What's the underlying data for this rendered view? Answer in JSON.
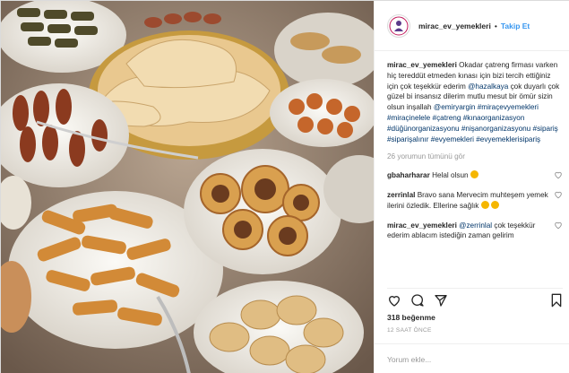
{
  "header": {
    "username": "mirac_ev_yemekleri",
    "separator": "•",
    "follow_label": "Takip Et"
  },
  "caption": {
    "username": "mirac_ev_yemekleri",
    "text_1": "Okadar çatreng firması varken hiç tereddüt etmeden kınası için bizi tercih ettiğiniz için çok teşekkür ederim",
    "mention_1": "@hazalkaya",
    "text_2": "çok duyarlı çok güzel bi insansız dilerim mutlu mesut bir ömür sizin olsun inşallah",
    "mention_2": "@emiryargin",
    "hashtags": [
      "#miraçevyemekleri",
      "#miraçinelele",
      "#çatreng",
      "#kınaorganizasyon",
      "#düğünorganizasyonu",
      "#nişanorganizasyonu",
      "#sipariş",
      "#siparişalınır",
      "#evyemekleri",
      "#evyemeklerisipariş"
    ]
  },
  "view_all": "26 yorumun tümünü gör",
  "comments": [
    {
      "username": "gbaharharar",
      "text": "Helal olsun"
    },
    {
      "username": "zerrinlal",
      "text": "Bravo sana Mervecim muhteşem yemek ilerini özledik. Ellerine sağlık"
    },
    {
      "username": "mirac_ev_yemekleri",
      "mention": "@zerrinlal",
      "text": "çok teşekkür ederim ablacım istediğin zaman gelirim"
    }
  ],
  "likes": "318 beğenme",
  "timestamp": "12 SAAT ÖNCE",
  "comment_input": {
    "placeholder": "Yorum ekle..."
  },
  "icons": {
    "like": "heart-icon",
    "comment": "comment-icon",
    "share": "share-icon",
    "save": "bookmark-icon"
  }
}
